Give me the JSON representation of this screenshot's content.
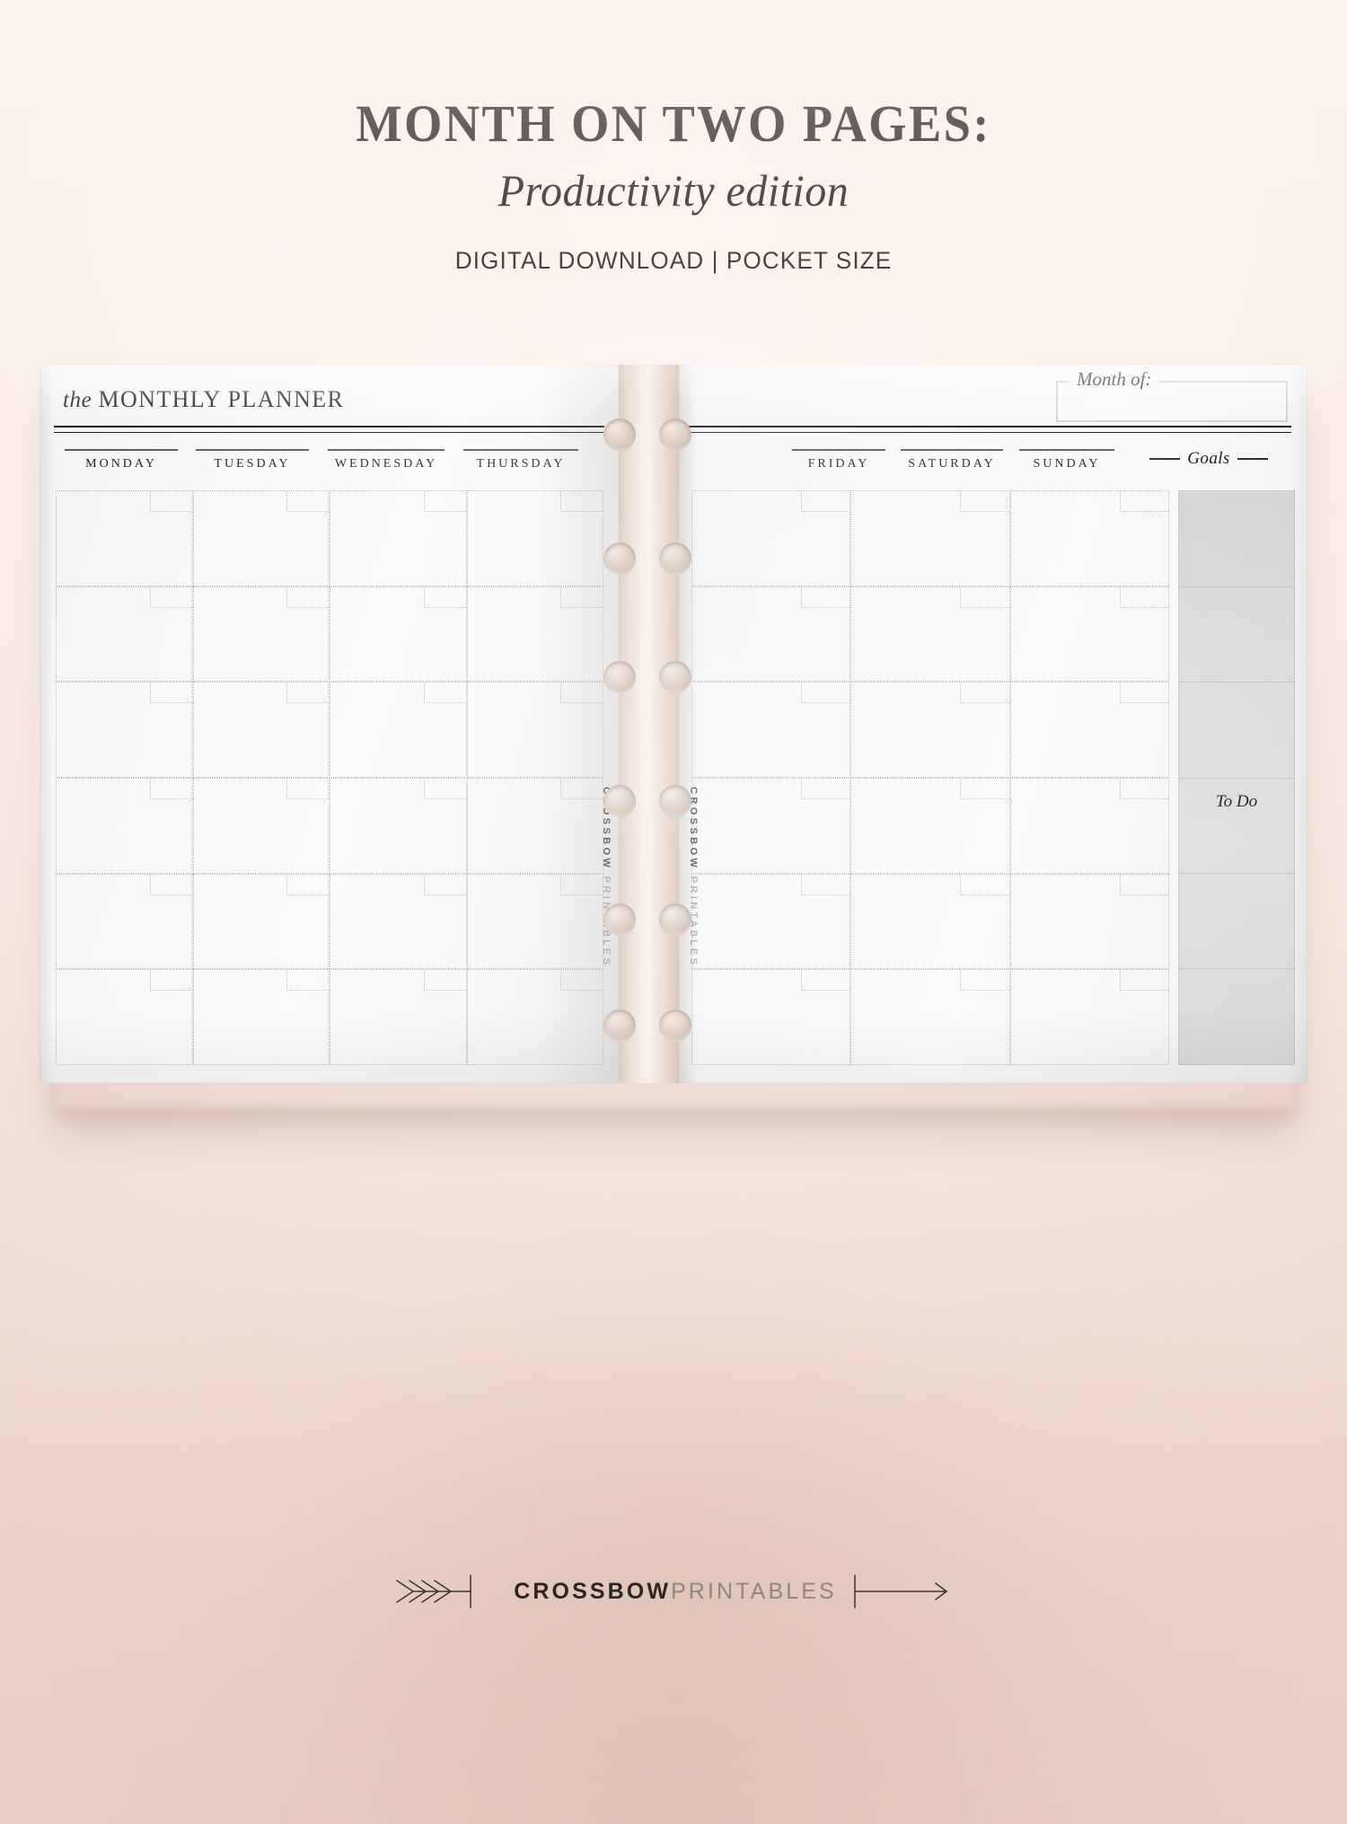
{
  "title": {
    "main": "MONTH ON TWO PAGES:",
    "sub": "Productivity edition",
    "meta": "DIGITAL DOWNLOAD | POCKET SIZE"
  },
  "left_page": {
    "header_the": "the",
    "header_title": "MONTHLY PLANNER",
    "days": [
      "MONDAY",
      "TUESDAY",
      "WEDNESDAY",
      "THURSDAY"
    ]
  },
  "right_page": {
    "month_of_label": "Month of:",
    "days": [
      "FRIDAY",
      "SATURDAY",
      "SUNDAY"
    ],
    "goals_label": "Goals",
    "todo_label": "To Do"
  },
  "spine": {
    "brand_top": "CROSSBOW",
    "brand_bottom": "PRINTABLES"
  },
  "footer": {
    "brand_bold": "CROSSBOW",
    "brand_light": "PRINTABLES"
  },
  "colors": {
    "background": "#f7e8e1",
    "paper": "#f7f7f8",
    "ink": "#15100e",
    "rule": "#58544f",
    "dotted": "#b7b7b9",
    "shaded_column": "#d9dadc",
    "hole": "#ddcec3"
  }
}
